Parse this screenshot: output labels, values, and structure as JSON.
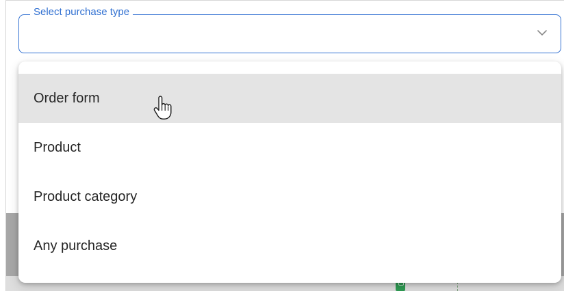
{
  "select": {
    "label": "Select purchase type",
    "value": ""
  },
  "menu": {
    "items": [
      {
        "label": "Order form",
        "highlighted": true
      },
      {
        "label": "Product",
        "highlighted": false
      },
      {
        "label": "Product category",
        "highlighted": false
      },
      {
        "label": "Any purchase",
        "highlighted": false
      }
    ]
  },
  "colors": {
    "accent": "#2f6fd1",
    "highlight": "#e4e4e4",
    "text": "#262626"
  },
  "icons": [
    "chevron-down-icon",
    "hand-pointer-cursor"
  ]
}
